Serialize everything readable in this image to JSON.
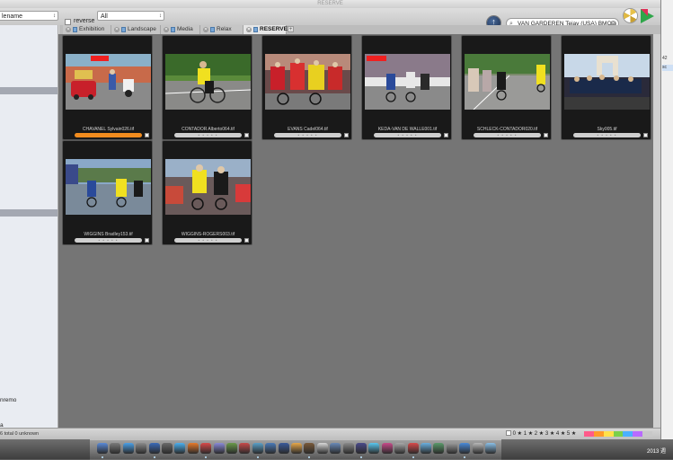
{
  "window": {
    "title": "RESERVE"
  },
  "toolbar": {
    "sort_select": "lename",
    "reverse_label": "reverse",
    "filter_select": "All",
    "search_value": "VAN GARDEREN Tejay (USA) BMC"
  },
  "tabs": [
    {
      "label": "Exhibition",
      "active": false
    },
    {
      "label": "Landscape",
      "active": false
    },
    {
      "label": "Media",
      "active": false
    },
    {
      "label": "Relax",
      "active": false
    },
    {
      "label": "RESERVE",
      "active": true
    }
  ],
  "sidebar": {
    "bottom_labels": [
      "nremo",
      "a"
    ]
  },
  "grid": {
    "items": [
      {
        "filename": "CHAVANEL Sylvain026.tif",
        "rating_color": "#f28c1e"
      },
      {
        "filename": "CONTADOR Alberto064.tif",
        "rating_color": "#cfcfcf"
      },
      {
        "filename": "EVANS Cadel064.tif",
        "rating_color": "#cfcfcf"
      },
      {
        "filename": "KEDA-VAN DE WALLE001.tif",
        "rating_color": "#cfcfcf"
      },
      {
        "filename": "SCHLECK-CONTADOR020.tif",
        "rating_color": "#cfcfcf"
      },
      {
        "filename": "Sky005.tif",
        "rating_color": "#cfcfcf"
      },
      {
        "filename": "WIGGINS Bradley153.tif",
        "rating_color": "#cfcfcf"
      },
      {
        "filename": "WIGGINS-ROGERS003.tif",
        "rating_color": "#cfcfcf"
      }
    ],
    "stars_placeholder": "• • • • •"
  },
  "statusbar": {
    "left": "6 total  0 unknown",
    "rating_filter": "0 ★ 1 ★ 2 ★ 3 ★ 4 ★ 5 ★",
    "color_labels": [
      "#ff5a8a",
      "#ff9a2a",
      "#ffe14a",
      "#7ad04a",
      "#4ab0ff",
      "#b86aff",
      "#c8c8c8"
    ]
  },
  "right_window": {
    "rows": [
      "42",
      "sc"
    ]
  },
  "dock": {
    "app_colors": [
      "#5a8ad8",
      "#7a7a7a",
      "#4aa0e8",
      "#8a8a8a",
      "#3a6ab8",
      "#6a6a6a",
      "#4ab0f0",
      "#e87a2a",
      "#d84a4a",
      "#8a8ad8",
      "#6a9a4a",
      "#c84a4a",
      "#5aa0c8",
      "#4a7ab8",
      "#3a5a9a",
      "#e8a84a",
      "#7a5a3a",
      "#d8d8d8",
      "#6a8ab8",
      "#8a8a8a",
      "#4a4a8a",
      "#5ac8f0",
      "#c84a8a",
      "#a8a8a8",
      "#d84a4a",
      "#6ab0e0",
      "#5a9a6a",
      "#9a9a9a",
      "#4a8ad8",
      "#b8b8b8",
      "#8ac0e8"
    ]
  },
  "system": {
    "clock": "2013 週"
  }
}
